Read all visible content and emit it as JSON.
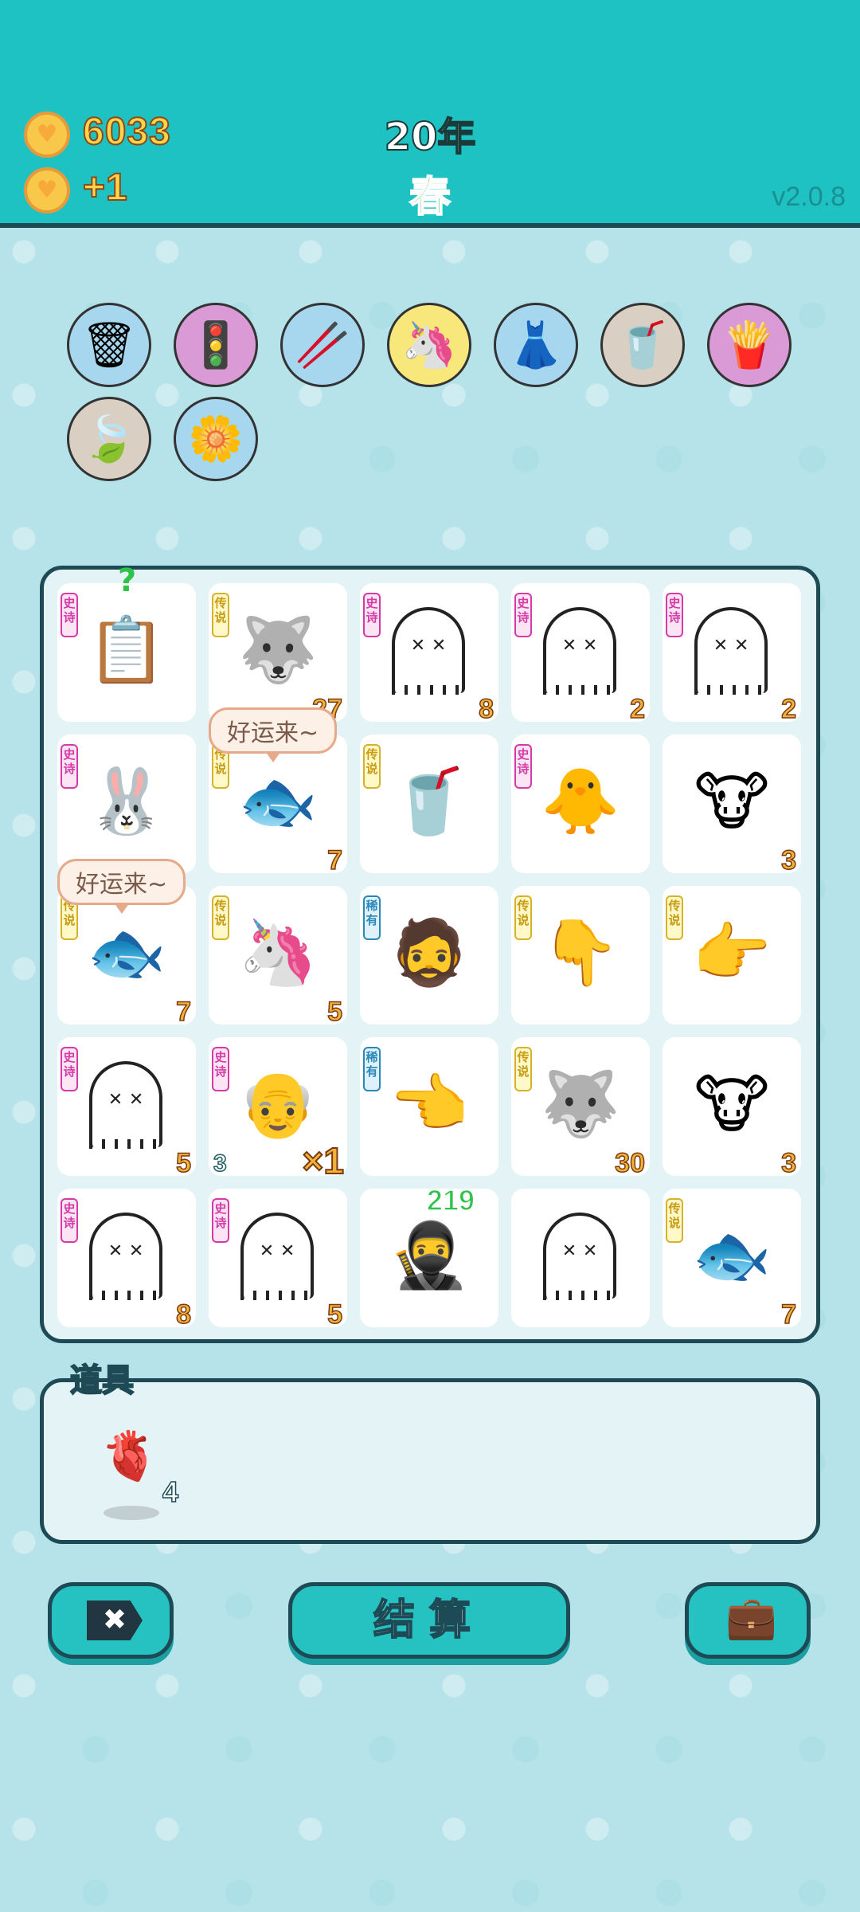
{
  "header": {
    "coins": "6033",
    "income": "+1",
    "year": "20年",
    "season": "春",
    "version": "v2.0.8"
  },
  "top_items": [
    {
      "icon": "garbage-bag-icon",
      "glyph": "🗑",
      "bg": "#a6d7ef"
    },
    {
      "icon": "traffic-light-ghost-icon",
      "glyph": "🚦",
      "bg": "#d99ad6"
    },
    {
      "icon": "chopsticks-icon",
      "glyph": "🥢",
      "bg": "#a6d7ef"
    },
    {
      "icon": "unicorn-icon",
      "glyph": "🦄",
      "bg": "#f8e77a",
      "badge": "heart"
    },
    {
      "icon": "skirt-icon",
      "glyph": "👗",
      "bg": "#a6d7ef"
    },
    {
      "icon": "bubble-tea-icon",
      "glyph": "🥤",
      "bg": "#d9d0c3"
    },
    {
      "icon": "fries-icon",
      "glyph": "🍟",
      "bg": "#d99ad6",
      "badge": "heart"
    },
    {
      "icon": "leaf-icon",
      "glyph": "🍃",
      "bg": "#d9d0c3",
      "badge": "heart"
    },
    {
      "icon": "potted-flower-icon",
      "glyph": "🌼",
      "bg": "#a6d7ef",
      "badge": "dot"
    }
  ],
  "board": {
    "cells": [
      {
        "icon": "copy-paste-icon",
        "glyph": "📋",
        "rarity": "史诗",
        "rarity_class": "epic",
        "qmark": "?",
        "num": ""
      },
      {
        "icon": "husky-king-icon",
        "glyph": "🐺",
        "rarity": "传说",
        "rarity_class": "legend",
        "num": "27"
      },
      {
        "icon": "ghost-icon",
        "glyph": "",
        "rarity": "史诗",
        "rarity_class": "epic",
        "num": "8"
      },
      {
        "icon": "ghost-icon",
        "glyph": "",
        "rarity": "史诗",
        "rarity_class": "epic",
        "num": "2"
      },
      {
        "icon": "ghost-icon",
        "glyph": "",
        "rarity": "史诗",
        "rarity_class": "epic",
        "num": "2"
      },
      {
        "icon": "rabbit-tent-icon",
        "glyph": "🐰",
        "rarity": "史诗",
        "rarity_class": "epic",
        "num": ""
      },
      {
        "icon": "koi-fish-icon",
        "glyph": "🐟",
        "rarity": "传说",
        "rarity_class": "legend",
        "num": "7"
      },
      {
        "icon": "bubble-tea-icon",
        "glyph": "🥤",
        "rarity": "传说",
        "rarity_class": "legend",
        "num": ""
      },
      {
        "icon": "yellow-face-icon",
        "glyph": "🐥",
        "rarity": "史诗",
        "rarity_class": "epic",
        "num": ""
      },
      {
        "icon": "cow-icon",
        "glyph": "🐮",
        "rarity": "",
        "rarity_class": "",
        "num": "3"
      },
      {
        "icon": "koi-fish-icon",
        "glyph": "🐟",
        "rarity": "传说",
        "rarity_class": "legend",
        "num": "7"
      },
      {
        "icon": "unicorn-icon",
        "glyph": "🦄",
        "rarity": "传说",
        "rarity_class": "legend",
        "num": "5"
      },
      {
        "icon": "bucket-hat-man-icon",
        "glyph": "🧔",
        "rarity": "稀有",
        "rarity_class": "rare",
        "num": ""
      },
      {
        "icon": "hand-point-down-icon",
        "glyph": "👇",
        "rarity": "传说",
        "rarity_class": "legend",
        "num": ""
      },
      {
        "icon": "hand-point-right-icon",
        "glyph": "👉",
        "rarity": "传说",
        "rarity_class": "legend",
        "num": ""
      },
      {
        "icon": "ghost-icon",
        "glyph": "",
        "rarity": "史诗",
        "rarity_class": "epic",
        "num": "5"
      },
      {
        "icon": "old-man-icon",
        "glyph": "👴",
        "rarity": "史诗",
        "rarity_class": "epic",
        "num_left": "3",
        "mult": "×1"
      },
      {
        "icon": "brown-hand-left-icon",
        "glyph": "👈",
        "rarity": "稀有",
        "rarity_class": "rare",
        "num": ""
      },
      {
        "icon": "husky-king-icon",
        "glyph": "🐺",
        "rarity": "传说",
        "rarity_class": "legend",
        "num": "30"
      },
      {
        "icon": "cow-icon",
        "glyph": "🐮",
        "rarity": "",
        "rarity_class": "",
        "num": "3"
      },
      {
        "icon": "ghost-icon",
        "glyph": "",
        "rarity": "史诗",
        "rarity_class": "epic",
        "num": "8"
      },
      {
        "icon": "ghost-icon",
        "glyph": "",
        "rarity": "史诗",
        "rarity_class": "epic",
        "num": "5"
      },
      {
        "icon": "thief-icon",
        "glyph": "🥷",
        "rarity": "",
        "rarity_class": "",
        "num_top": "219"
      },
      {
        "icon": "ghost-icon",
        "glyph": "",
        "rarity": "",
        "rarity_class": "",
        "num": ""
      },
      {
        "icon": "koi-fish-icon",
        "glyph": "🐟",
        "rarity": "传说",
        "rarity_class": "legend",
        "num": "7"
      }
    ],
    "bubbles": [
      "好运来~",
      "好运来~"
    ]
  },
  "props": {
    "title": "道具",
    "items": [
      {
        "icon": "liver-icon",
        "glyph": "🫀",
        "count": "4"
      }
    ]
  },
  "buttons": {
    "delete": "✖",
    "settle": "结算",
    "bag": "💼"
  },
  "colors": {
    "header": "#1fc2c2",
    "accent": "#26c2c2",
    "border": "#1e4a55"
  }
}
